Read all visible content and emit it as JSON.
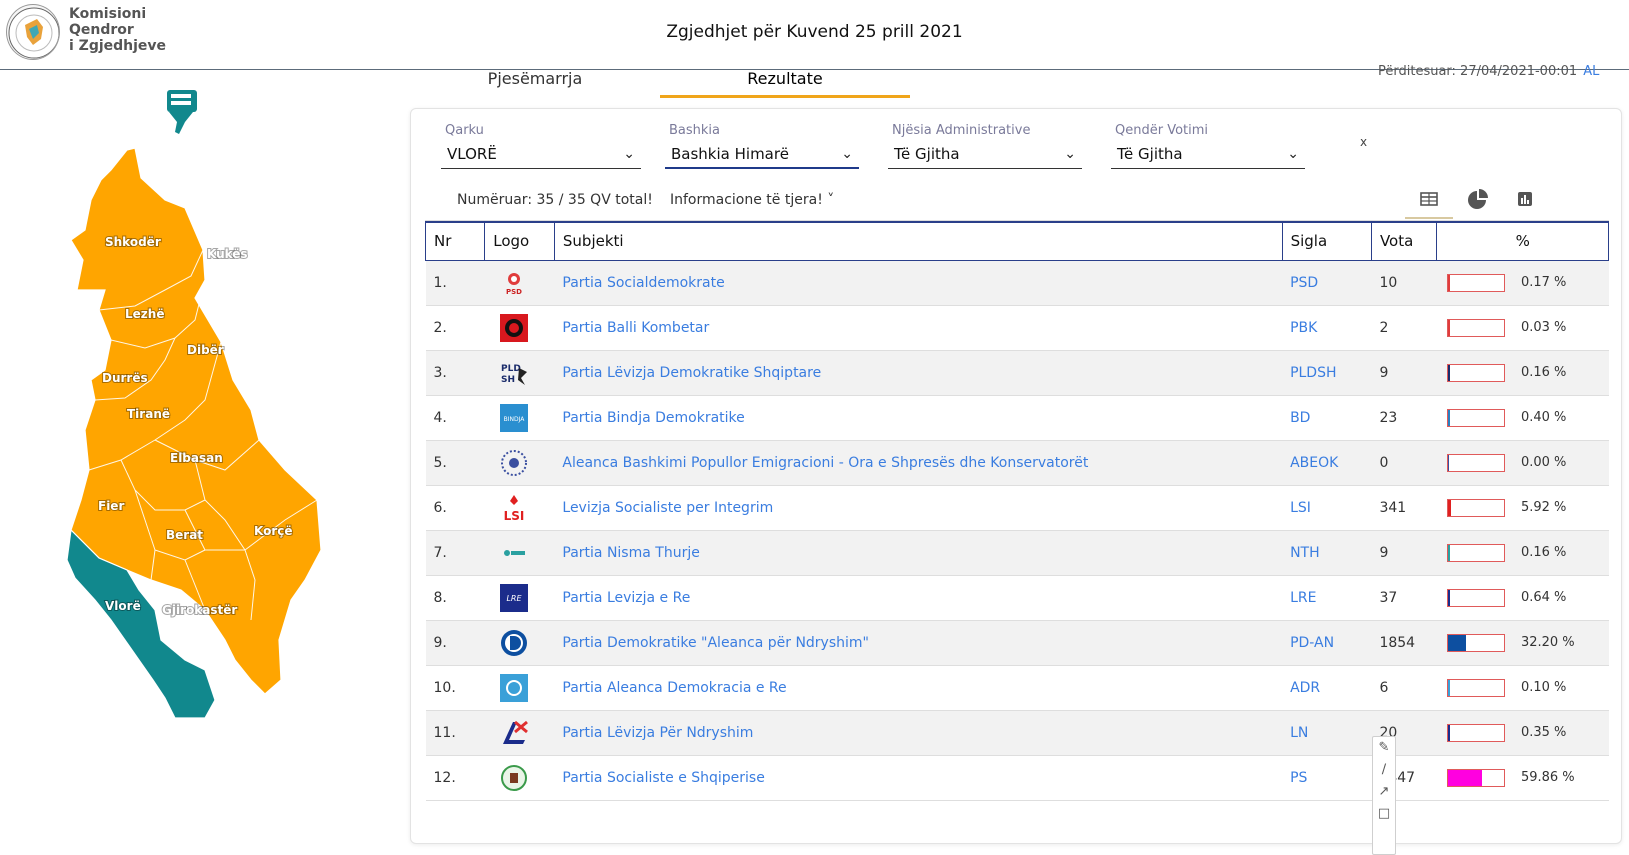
{
  "brand": {
    "line1": "Komisioni",
    "line2": "Qendror",
    "line3": "i Zgjedhjeve"
  },
  "page_title": "Zgjedhjet për Kuvend 25 prill 2021",
  "tabs": {
    "participation": "Pjesëmarrja",
    "results": "Rezultate"
  },
  "updated": {
    "text": "Përditesuar: 27/04/2021-00:01",
    "lang": "AL"
  },
  "map": {
    "regions": [
      "Shkodër",
      "Kukës",
      "Lezhë",
      "Dibër",
      "Durrës",
      "Tiranë",
      "Elbasan",
      "Fier",
      "Berat",
      "Korçë",
      "Vlorë",
      "Gjirokastër"
    ],
    "selected": "Vlorë",
    "colors": {
      "default": "#ffa500",
      "selected": "#11888d"
    }
  },
  "filters": {
    "qarku": {
      "label": "Qarku",
      "value": "VLORË"
    },
    "bashkia": {
      "label": "Bashkia",
      "value": "Bashkia Himarë"
    },
    "njesia": {
      "label": "Njësia Administrative",
      "value": "Të Gjitha"
    },
    "qender": {
      "label": "Qendër Votimi",
      "value": "Të Gjitha"
    },
    "clear": "x"
  },
  "subbar": {
    "counted": "Numëruar: 35 / 35 QV total!",
    "more_info": "Informacione të tjera! ˅"
  },
  "table": {
    "headers": {
      "nr": "Nr",
      "logo": "Logo",
      "subject": "Subjekti",
      "sigla": "Sigla",
      "votes": "Vota",
      "pct": "%"
    },
    "rows": [
      {
        "nr": "1.",
        "subject": "Partia Socialdemokrate",
        "sigla": "PSD",
        "votes": "10",
        "pct": "0.17 %",
        "share": 0.0017,
        "color": "#e03c3c",
        "logo": "psd-logo"
      },
      {
        "nr": "2.",
        "subject": "Partia Balli Kombetar",
        "sigla": "PBK",
        "votes": "2",
        "pct": "0.03 %",
        "share": 0.0003,
        "color": "#e03c3c",
        "logo": "pbk-logo"
      },
      {
        "nr": "3.",
        "subject": "Partia Lëvizja Demokratike Shqiptare",
        "sigla": "PLDSH",
        "votes": "9",
        "pct": "0.16 %",
        "share": 0.0016,
        "color": "#1b2c6b",
        "logo": "pldsh-logo"
      },
      {
        "nr": "4.",
        "subject": "Partia Bindja Demokratike",
        "sigla": "BD",
        "votes": "23",
        "pct": "0.40 %",
        "share": 0.004,
        "color": "#2a7fc0",
        "logo": "bd-logo"
      },
      {
        "nr": "5.",
        "subject": "Aleanca Bashkimi Popullor Emigracioni - Ora e Shpresës dhe Konservatorët",
        "sigla": "ABEOK",
        "votes": "0",
        "pct": "0.00 %",
        "share": 0,
        "color": "#3a4fa0",
        "logo": "abeok-logo"
      },
      {
        "nr": "6.",
        "subject": "Levizja Socialiste per Integrim",
        "sigla": "LSI",
        "votes": "341",
        "pct": "5.92 %",
        "share": 0.0592,
        "color": "#e02020",
        "logo": "lsi-logo"
      },
      {
        "nr": "7.",
        "subject": "Partia Nisma Thurje",
        "sigla": "NTH",
        "votes": "9",
        "pct": "0.16 %",
        "share": 0.0016,
        "color": "#2aa0a0",
        "logo": "nth-logo"
      },
      {
        "nr": "8.",
        "subject": "Partia Levizja e Re",
        "sigla": "LRE",
        "votes": "37",
        "pct": "0.64 %",
        "share": 0.0064,
        "color": "#1b2c8b",
        "logo": "lre-logo"
      },
      {
        "nr": "9.",
        "subject": "Partia Demokratike \"Aleanca për Ndryshim\"",
        "sigla": "PD-AN",
        "votes": "1854",
        "pct": "32.20 %",
        "share": 0.322,
        "color": "#0d4fa0",
        "logo": "pd-logo"
      },
      {
        "nr": "10.",
        "subject": "Partia Aleanca Demokracia e Re",
        "sigla": "ADR",
        "votes": "6",
        "pct": "0.10 %",
        "share": 0.001,
        "color": "#3aa0d8",
        "logo": "adr-logo"
      },
      {
        "nr": "11.",
        "subject": "Partia Lëvizja Për Ndryshim",
        "sigla": "LN",
        "votes": "20",
        "pct": "0.35 %",
        "share": 0.0035,
        "color": "#1b2c8b",
        "logo": "ln-logo"
      },
      {
        "nr": "12.",
        "subject": "Partia Socialiste e Shqiperise",
        "sigla": "PS",
        "votes": "3447",
        "pct": "59.86 %",
        "share": 0.5986,
        "color": "#ff00e0",
        "logo": "ps-logo"
      }
    ]
  }
}
